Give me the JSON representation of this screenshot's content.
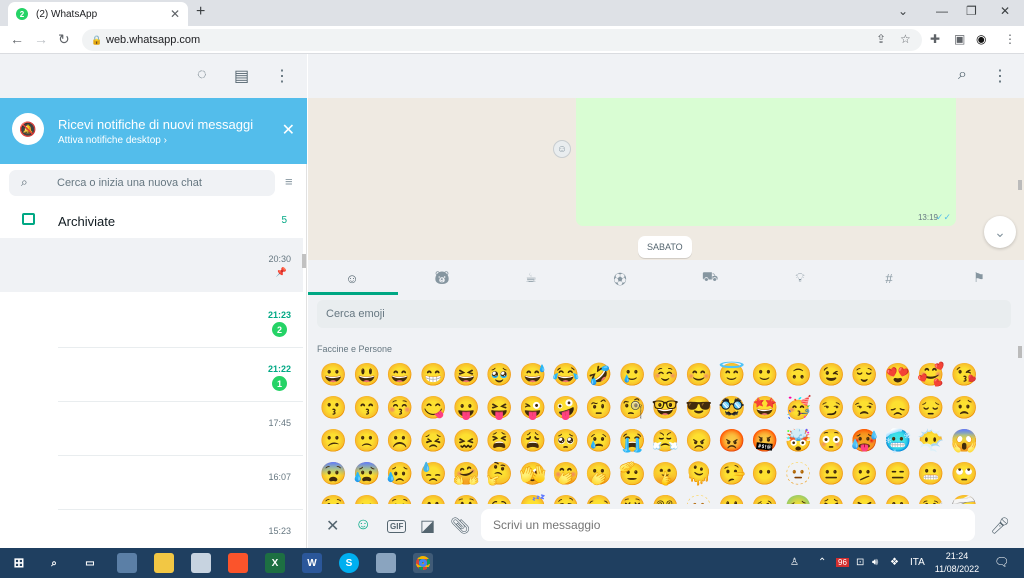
{
  "browser": {
    "tab_title": "(2) WhatsApp",
    "tab_badge": "2",
    "url": "web.whatsapp.com",
    "icons": [
      "new-tab-icon",
      "back-icon",
      "forward-icon",
      "reload-icon",
      "lock-icon",
      "share-icon",
      "star-icon",
      "extensions-icon",
      "sidepanel-icon",
      "profile-icon",
      "menu-icon"
    ]
  },
  "notification": {
    "title": "Ricevi notifiche di nuovi messaggi",
    "link": "Attiva notifiche desktop ›"
  },
  "search": {
    "placeholder": "Cerca o inizia una nuova chat"
  },
  "archived": {
    "label": "Archiviate",
    "count": "5"
  },
  "chats": [
    {
      "time": "20:30",
      "pinned": true,
      "unread": ""
    },
    {
      "time": "21:23",
      "pinned": false,
      "unread": "2"
    },
    {
      "time": "21:22",
      "pinned": false,
      "unread": "1"
    },
    {
      "time": "17:45",
      "pinned": false,
      "unread": ""
    },
    {
      "time": "16:07",
      "pinned": false,
      "unread": ""
    },
    {
      "time": "15:23",
      "pinned": false,
      "unread": ""
    }
  ],
  "conversation": {
    "message_time": "13:19",
    "day_label": "SABATO"
  },
  "emoji": {
    "search_placeholder": "Cerca emoji",
    "section_title": "Faccine e Persone",
    "categories": [
      "smiley-icon",
      "animal-icon",
      "food-icon",
      "activity-icon",
      "travel-icon",
      "objects-icon",
      "symbols-icon",
      "flags-icon"
    ],
    "items": [
      "😀",
      "😃",
      "😄",
      "😁",
      "😆",
      "🥹",
      "😅",
      "😂",
      "🤣",
      "🥲",
      "☺️",
      "😊",
      "😇",
      "🙂",
      "🙃",
      "😉",
      "😌",
      "😍",
      "🥰",
      "😘",
      "😗",
      "😙",
      "😚",
      "😋",
      "😛",
      "😝",
      "😜",
      "🤪",
      "🤨",
      "🧐",
      "🤓",
      "😎",
      "🥸",
      "🤩",
      "🥳",
      "😏",
      "😒",
      "😞",
      "😔",
      "😟",
      "😕",
      "🙁",
      "☹️",
      "😣",
      "😖",
      "😫",
      "😩",
      "🥺",
      "😢",
      "😭",
      "😤",
      "😠",
      "😡",
      "🤬",
      "🤯",
      "😳",
      "🥵",
      "🥶",
      "😶‍🌫️",
      "😱",
      "😨",
      "😰",
      "😥",
      "😓",
      "🤗",
      "🤔",
      "🫣",
      "🤭",
      "🫢",
      "🫡",
      "🤫",
      "🫠",
      "🤥",
      "😶",
      "🫥",
      "😐",
      "🫤",
      "😑",
      "😬",
      "🙄",
      "😯",
      "😦",
      "😧",
      "😮",
      "😲",
      "🥱",
      "😴",
      "🤤",
      "😪",
      "😵",
      "😵‍💫",
      "🫥",
      "🤐",
      "🥴",
      "🤢",
      "🤮",
      "🤧",
      "😷",
      "🤒",
      "🤕"
    ]
  },
  "composer": {
    "placeholder": "Scrivi un messaggio"
  },
  "taskbar": {
    "tray_badge": "96",
    "language": "ITA",
    "time": "21:24",
    "date": "11/08/2022"
  },
  "colors": {
    "accent": "#00a884",
    "notification_bg": "#53bdeb",
    "bubble_out": "#d9fdd3",
    "chat_bg": "#efeae2"
  }
}
